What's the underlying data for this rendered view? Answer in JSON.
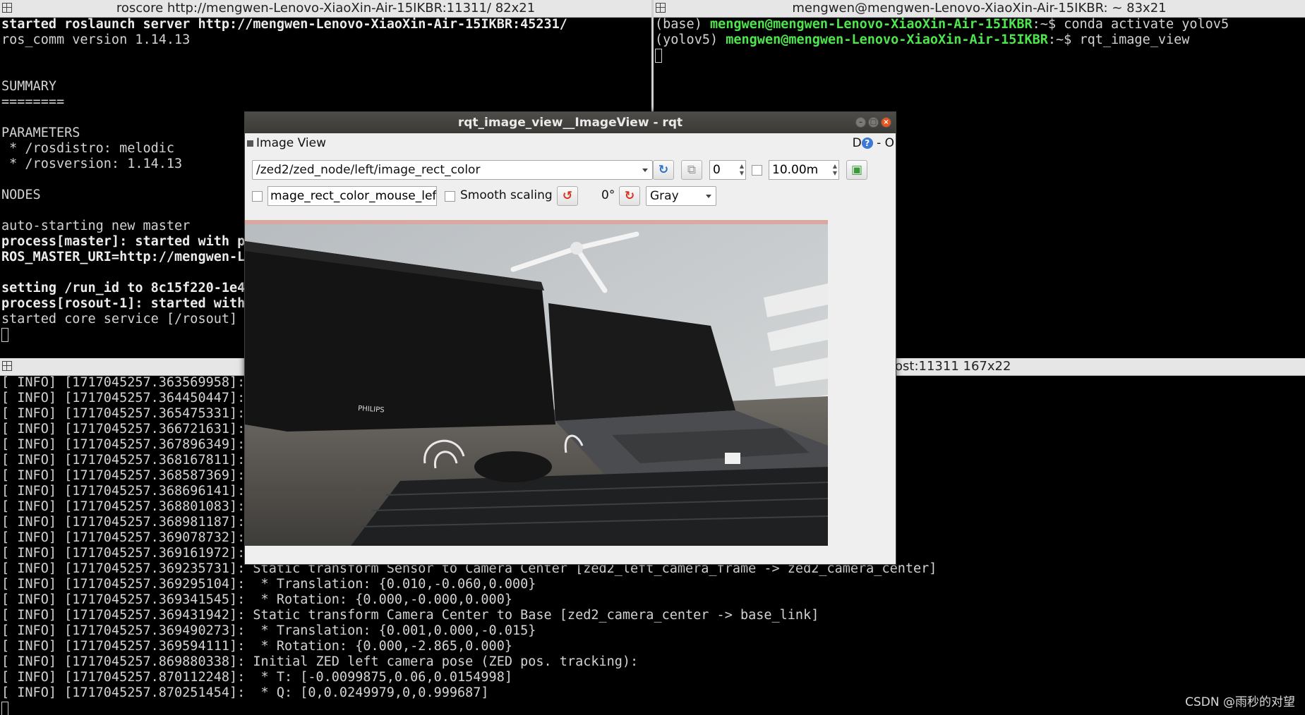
{
  "term1": {
    "title": "roscore http://mengwen-Lenovo-XiaoXin-Air-15IKBR:11311/ 82x21",
    "lines": [
      {
        "text": "started roslaunch server http://mengwen-Lenovo-XiaoXin-Air-15IKBR:45231/",
        "bold": true
      },
      {
        "text": "ros_comm version 1.14.13",
        "bold": false
      },
      {
        "text": "",
        "bold": false
      },
      {
        "text": "",
        "bold": false
      },
      {
        "text": "SUMMARY",
        "bold": false
      },
      {
        "text": "========",
        "bold": false
      },
      {
        "text": "",
        "bold": false
      },
      {
        "text": "PARAMETERS",
        "bold": false
      },
      {
        "text": " * /rosdistro: melodic",
        "bold": false
      },
      {
        "text": " * /rosversion: 1.14.13",
        "bold": false
      },
      {
        "text": "",
        "bold": false
      },
      {
        "text": "NODES",
        "bold": false
      },
      {
        "text": "",
        "bold": false
      },
      {
        "text": "auto-starting new master",
        "bold": false
      },
      {
        "text": "process[master]: started with pid",
        "bold": true
      },
      {
        "text": "ROS_MASTER_URI=http://mengwen-Le",
        "bold": true
      },
      {
        "text": "",
        "bold": false
      },
      {
        "text": "setting /run_id to 8c15f220-1e4",
        "bold": true
      },
      {
        "text": "process[rosout-1]: started with",
        "bold": true
      },
      {
        "text": "started core service [/rosout]",
        "bold": false
      }
    ]
  },
  "term2": {
    "title": "mengwen@mengwen-Lenovo-XiaoXin-Air-15IKBR: ~ 83x21",
    "lines": [
      {
        "env": "(base) ",
        "user": "mengwen@mengwen-Lenovo-XiaoXin-Air-15IKBR",
        "sep": ":~$ ",
        "cmd": "conda activate yolov5"
      },
      {
        "env": "(yolov5) ",
        "user": "mengwen@mengwen-Lenovo-XiaoXin-Air-15IKBR",
        "sep": ":~$ ",
        "cmd": "rqt_image_view"
      }
    ]
  },
  "term3": {
    "title": "ost:11311 167x22",
    "lines": [
      "[ INFO] [1717045257.363569958]:",
      "[ INFO] [1717045257.364450447]:",
      "[ INFO] [1717045257.365475331]:",
      "[ INFO] [1717045257.366721631]:",
      "[ INFO] [1717045257.367896349]:",
      "[ INFO] [1717045257.368167811]:",
      "[ INFO] [1717045257.368587369]:",
      "[ INFO] [1717045257.368696141]:",
      "[ INFO] [1717045257.368801083]:",
      "[ INFO] [1717045257.368981187]:",
      "[ INFO] [1717045257.369078732]:",
      "[ INFO] [1717045257.369161972]:",
      "[ INFO] [1717045257.369235731]: Static transform Sensor to Camera Center [zed2_left_camera_frame -> zed2_camera_center]",
      "[ INFO] [1717045257.369295104]:  * Translation: {0.010,-0.060,0.000}",
      "[ INFO] [1717045257.369341545]:  * Rotation: {0.000,-0.000,0.000}",
      "[ INFO] [1717045257.369431942]: Static transform Camera Center to Base [zed2_camera_center -> base_link]",
      "[ INFO] [1717045257.369490273]:  * Translation: {0.001,0.000,-0.015}",
      "[ INFO] [1717045257.369594111]:  * Rotation: {0.000,-2.865,0.000}",
      "[ INFO] [1717045257.869880338]: Initial ZED left camera pose (ZED pos. tracking):",
      "[ INFO] [1717045257.870112248]:  * T: [-0.0099875,0.06,0.0154998]",
      "[ INFO] [1717045257.870251454]:  * Q: [0,0.0249979,0,0.999687]"
    ]
  },
  "rqt": {
    "window_title": "rqt_image_view__ImageView - rqt",
    "dock_title": "Image View",
    "dock_right_d": "D",
    "dock_right_help": "?",
    "dock_right_rest": "- O",
    "topic": "/zed2/zed_node/left/image_rect_color",
    "spin_value": "0",
    "max_value": "10.00m",
    "mouse_topic": "mage_rect_color_mouse_left",
    "smooth_label": "Smooth scaling",
    "rotation": "0°",
    "color_scheme": "Gray"
  },
  "watermark": "CSDN @雨秒的对望",
  "colors": {
    "terminal_bg": "#000000",
    "prompt_user": "#4ee54e",
    "rqt_bg": "#efefef",
    "close_button": "#e9541f"
  }
}
